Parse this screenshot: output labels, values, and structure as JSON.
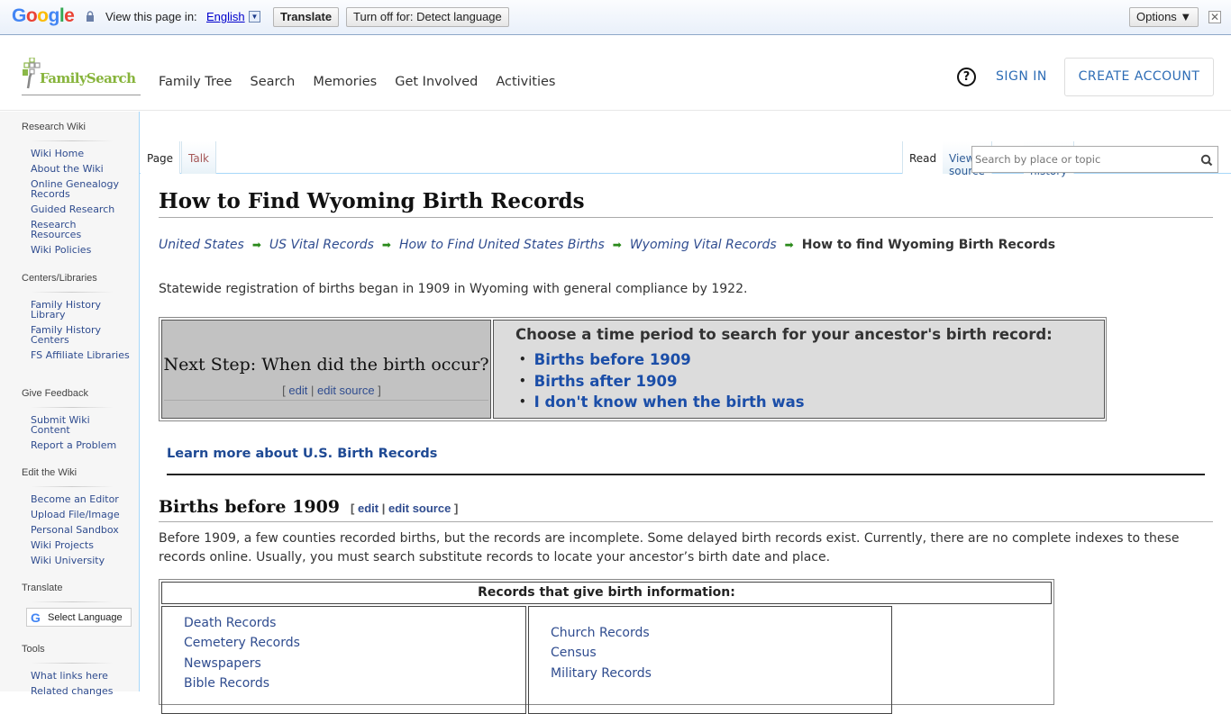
{
  "translate_bar": {
    "brand": "Google",
    "view_label": "View this page in:",
    "language": "English",
    "translate_button": "Translate",
    "turn_off_button": "Turn off for: Detect language",
    "options_button": "Options ▼",
    "close": "✕"
  },
  "header": {
    "logo_text": "FamilySearch",
    "nav": [
      "Family Tree",
      "Search",
      "Memories",
      "Get Involved",
      "Activities"
    ],
    "help_icon": "?",
    "sign_in": "SIGN IN",
    "create_account": "CREATE ACCOUNT"
  },
  "sidebar": {
    "sections": [
      {
        "title": "Research Wiki",
        "items": [
          "Wiki Home",
          "About the Wiki",
          "Online Genealogy Records",
          "Guided Research",
          "Research Resources",
          "Wiki Policies"
        ]
      },
      {
        "title": "Centers/Libraries",
        "items": [
          "Family History Library",
          "Family History Centers",
          "FS Affiliate Libraries"
        ]
      },
      {
        "title": "Give Feedback",
        "items": [
          "Submit Wiki Content",
          "Report a Problem"
        ]
      },
      {
        "title": "Edit the Wiki",
        "items": [
          "Become an Editor",
          "Upload File/Image",
          "Personal Sandbox",
          "Wiki Projects",
          "Wiki University"
        ]
      },
      {
        "title": "Translate",
        "items": []
      },
      {
        "title": "Tools",
        "items": [
          "What links here",
          "Related changes"
        ]
      }
    ],
    "select_language": "Select Language"
  },
  "tabs": {
    "page": "Page",
    "talk": "Talk",
    "read": "Read",
    "view_source": "View source",
    "view_history": "View history",
    "search_placeholder": "Search by place or topic"
  },
  "article": {
    "title": "How to Find Wyoming Birth Records",
    "breadcrumbs": [
      "United States",
      "US Vital Records",
      "How to Find United States Births",
      "Wyoming Vital Records"
    ],
    "breadcrumb_current": "How to find Wyoming Birth Records",
    "intro": "Statewide registration of births began in 1909 in Wyoming with general compliance by 1922.",
    "next_step": {
      "question": "Next Step: When did the birth occur?",
      "edit": "edit",
      "edit_source": "edit source",
      "choose_heading": "Choose a time period to search for your ancestor's birth record:",
      "options": [
        "Births before 1909",
        "Births after 1909",
        "I don't know when the birth was"
      ]
    },
    "learn_more": "Learn more about U.S. Birth Records",
    "section1": {
      "heading": "Births before 1909",
      "edit": "edit",
      "edit_source": "edit source",
      "text": "Before 1909, a few counties recorded births, but the records are incomplete. Some delayed birth records exist. Currently, there are no complete indexes to these records online. Usually, you must search substitute records to locate your ancestor’s birth date and place."
    },
    "records_table": {
      "heading": "Records that give birth information:",
      "left": [
        "Death Records",
        "Cemetery Records",
        "Newspapers",
        "Bible Records"
      ],
      "right": [
        "Church Records",
        "Census",
        "Military Records"
      ]
    }
  }
}
